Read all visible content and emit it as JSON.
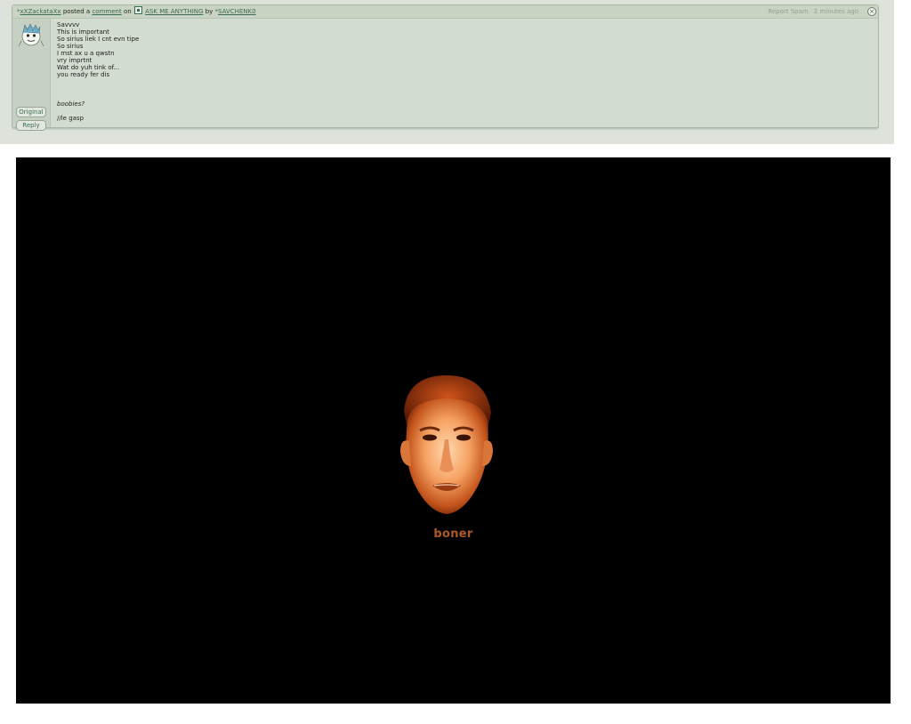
{
  "header": {
    "author_symbol": "*",
    "author": "xXZackataXx",
    "posted_a": "posted a",
    "comment_link": "comment",
    "on": "on",
    "deviation_title": "ASK ME ANYTHING",
    "by": "by",
    "owner_symbol": "*",
    "owner": "SAVCHENK0",
    "report_spam": "Report Spam",
    "timestamp": "2 minutes ago",
    "close_symbol": "×"
  },
  "buttons": {
    "original": "Original",
    "reply": "Reply"
  },
  "comment": {
    "body": "Savvvv\nThis is important\nSo sirius liek I cnt evn tipe\nSo sirius\nI mst ax u a qwstn\nvry imprtnt\nWat do yuh tink of...\nyou ready fer dis",
    "quote": "boobies?",
    "reply": "//le gasp"
  },
  "image": {
    "caption": "boner"
  },
  "colors": {
    "panel_bg": "#dde3da",
    "comment_bg": "#d3dcd0",
    "link": "#3b6b52",
    "caption": "#ad5a22",
    "image_bg": "#000000"
  }
}
